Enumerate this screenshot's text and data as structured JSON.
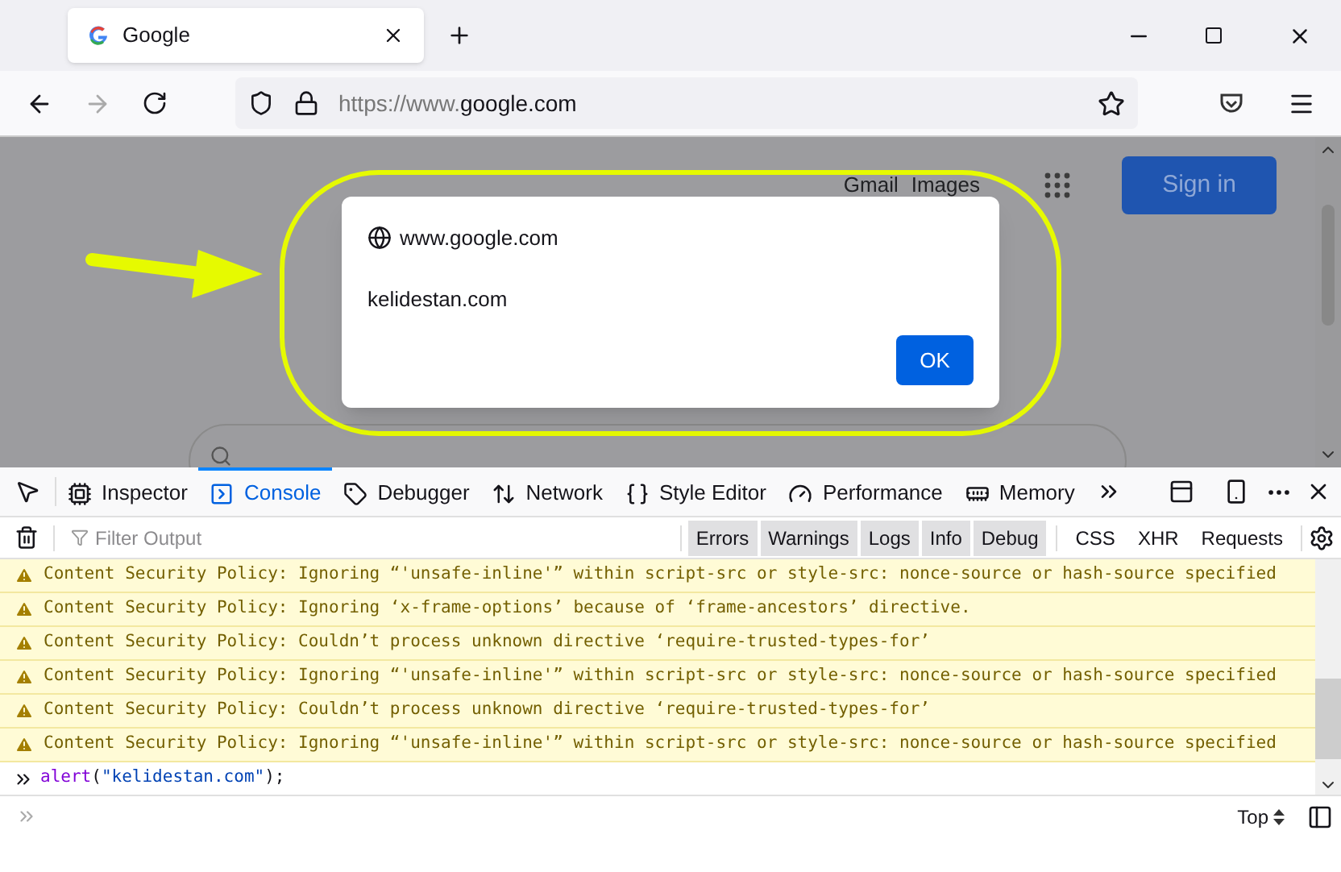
{
  "browser_tab": {
    "title": "Google"
  },
  "address_bar": {
    "prefix": "https://www.",
    "domain": "google.com"
  },
  "page": {
    "links": [
      "Gmail",
      "Images"
    ],
    "sign_in": "Sign in"
  },
  "alert": {
    "origin": "www.google.com",
    "message": "kelidestan.com",
    "button": "OK"
  },
  "devtools_tabs": [
    {
      "label": "Inspector",
      "selected": false
    },
    {
      "label": "Console",
      "selected": true
    },
    {
      "label": "Debugger",
      "selected": false
    },
    {
      "label": "Network",
      "selected": false
    },
    {
      "label": "Style Editor",
      "selected": false
    },
    {
      "label": "Performance",
      "selected": false
    },
    {
      "label": "Memory",
      "selected": false
    }
  ],
  "filter": {
    "placeholder": "Filter Output"
  },
  "levels": [
    {
      "label": "Errors",
      "on": true
    },
    {
      "label": "Warnings",
      "on": true
    },
    {
      "label": "Logs",
      "on": true
    },
    {
      "label": "Info",
      "on": true
    },
    {
      "label": "Debug",
      "on": true
    }
  ],
  "network_filters": [
    {
      "label": "CSS",
      "on": false
    },
    {
      "label": "XHR",
      "on": false
    },
    {
      "label": "Requests",
      "on": false
    }
  ],
  "messages": [
    {
      "kind": "warning",
      "text": "Content Security Policy: Ignoring “'unsafe-inline'” within script-src or style-src: nonce-source or hash-source specified"
    },
    {
      "kind": "warning",
      "text": "Content Security Policy: Ignoring ‘x-frame-options’ because of ‘frame-ancestors’ directive."
    },
    {
      "kind": "warning",
      "text": "Content Security Policy: Couldn’t process unknown directive ‘require-trusted-types-for’"
    },
    {
      "kind": "warning",
      "text": "Content Security Policy: Ignoring “'unsafe-inline'” within script-src or style-src: nonce-source or hash-source specified"
    },
    {
      "kind": "warning",
      "text": "Content Security Policy: Couldn’t process unknown directive ‘require-trusted-types-for’"
    },
    {
      "kind": "warning",
      "text": "Content Security Policy: Ignoring “'unsafe-inline'” within script-src or style-src: nonce-source or hash-source specified"
    }
  ],
  "console_input": {
    "function": "alert",
    "open": "(",
    "argument": "\"kelidestan.com\"",
    "close": ");"
  },
  "context": {
    "label": "Top"
  }
}
